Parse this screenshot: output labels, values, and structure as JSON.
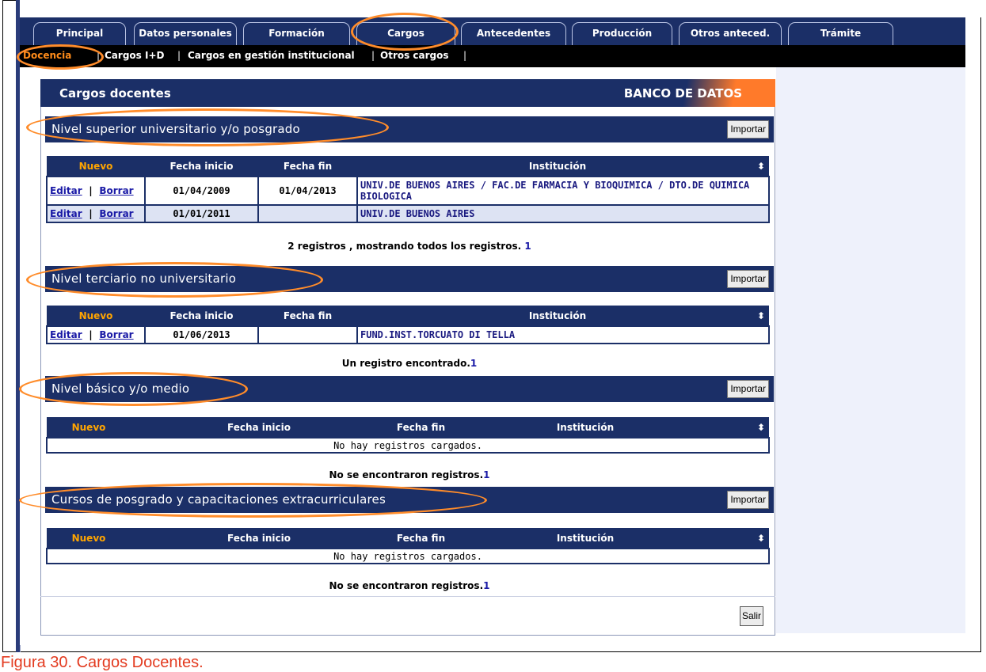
{
  "tabs": [
    "Principal",
    "Datos personales",
    "Formación",
    "Cargos",
    "Antecedentes",
    "Producción",
    "Otros anteced.",
    "Trámite"
  ],
  "subnav": {
    "active": "Docencia",
    "items": [
      "Cargos I+D",
      "Cargos en gestión institucional",
      "Otros cargos"
    ]
  },
  "page": {
    "title": "Cargos docentes",
    "banner": "BANCO DE DATOS"
  },
  "sections": [
    {
      "title": "Nivel superior universitario y/o posgrado",
      "import": "Importar",
      "headers": [
        "Nuevo",
        "Fecha inicio",
        "Fecha fin",
        "Institución"
      ],
      "rows": [
        {
          "edit": "Editar",
          "delete": "Borrar",
          "start": "01/04/2009",
          "end": "01/04/2013",
          "institution": "UNIV.DE BUENOS AIRES / FAC.DE FARMACIA Y BIOQUIMICA / DTO.DE QUIMICA BIOLOGICA"
        },
        {
          "edit": "Editar",
          "delete": "Borrar",
          "start": "01/01/2011",
          "end": "",
          "institution": "UNIV.DE BUENOS AIRES"
        }
      ],
      "footer": "2 registros , mostrando todos los registros.",
      "page": "1"
    },
    {
      "title": "Nivel terciario no universitario",
      "import": "Importar",
      "headers": [
        "Nuevo",
        "Fecha inicio",
        "Fecha fin",
        "Institución"
      ],
      "rows": [
        {
          "edit": "Editar",
          "delete": "Borrar",
          "start": "01/06/2013",
          "end": "",
          "institution": "FUND.INST.TORCUATO DI TELLA"
        }
      ],
      "footer": "Un registro encontrado.",
      "page": "1"
    },
    {
      "title": "Nivel básico y/o medio",
      "import": "Importar",
      "headers": [
        "Nuevo",
        "Fecha inicio",
        "Fecha fin",
        "Institución"
      ],
      "empty": "No hay registros cargados.",
      "footer": "No se encontraron registros.",
      "page": "1"
    },
    {
      "title": "Cursos de posgrado y capacitaciones extracurriculares",
      "import": "Importar",
      "headers": [
        "Nuevo",
        "Fecha inicio",
        "Fecha fin",
        "Institución"
      ],
      "empty": "No hay registros cargados.",
      "footer": "No se encontraron registros.",
      "page": "1"
    }
  ],
  "buttons": {
    "salir": "Salir"
  },
  "caption": "Figura 30. Cargos Docentes.",
  "colors": {
    "navy": "#1b2f67",
    "highlight": "#ff8c2a",
    "caption": "#e33b20"
  }
}
